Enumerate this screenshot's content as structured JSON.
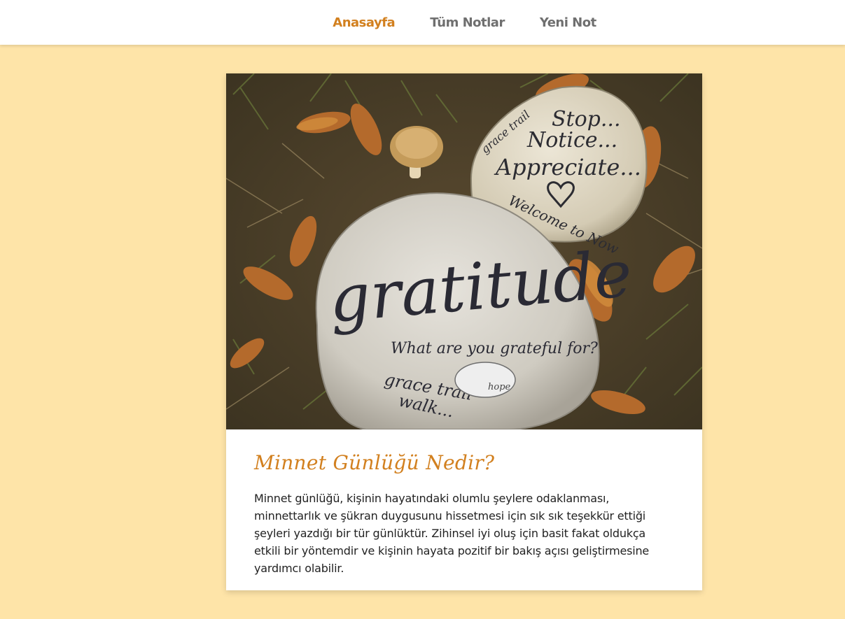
{
  "nav": {
    "items": [
      {
        "label": "Anasayfa",
        "active": true
      },
      {
        "label": "Tüm Notlar",
        "active": false
      },
      {
        "label": "Yeni Not",
        "active": false
      }
    ]
  },
  "card": {
    "image": {
      "big_stone": {
        "main": "gratitude",
        "question": "What are you grateful for?",
        "footer_1": "grace trail",
        "footer_2": "walk...",
        "badge": "hope"
      },
      "small_stone": {
        "side": "grace trail",
        "line_1": "Stop...",
        "line_2": "Notice...",
        "line_3": "Appreciate...",
        "line_4": "Welcome to Now"
      }
    },
    "title": "Minnet Günlüğü Nedir?",
    "text": "Minnet günlüğü, kişinin hayatındaki olumlu şeylere odaklanması, minnettarlık ve şükran duygusunu hissetmesi için sık sık teşekkür ettiği şeyleri yazdığı bir tür günlüktür. Zihinsel iyi oluş için basit fakat oldukça etkili bir yöntemdir ve kişinin hayata pozitif bir bakış açısı geliştirmesine yardımcı olabilir."
  },
  "colors": {
    "background": "#fee4a8",
    "accent": "#d2801f",
    "nav_text": "#6f6f6f"
  }
}
